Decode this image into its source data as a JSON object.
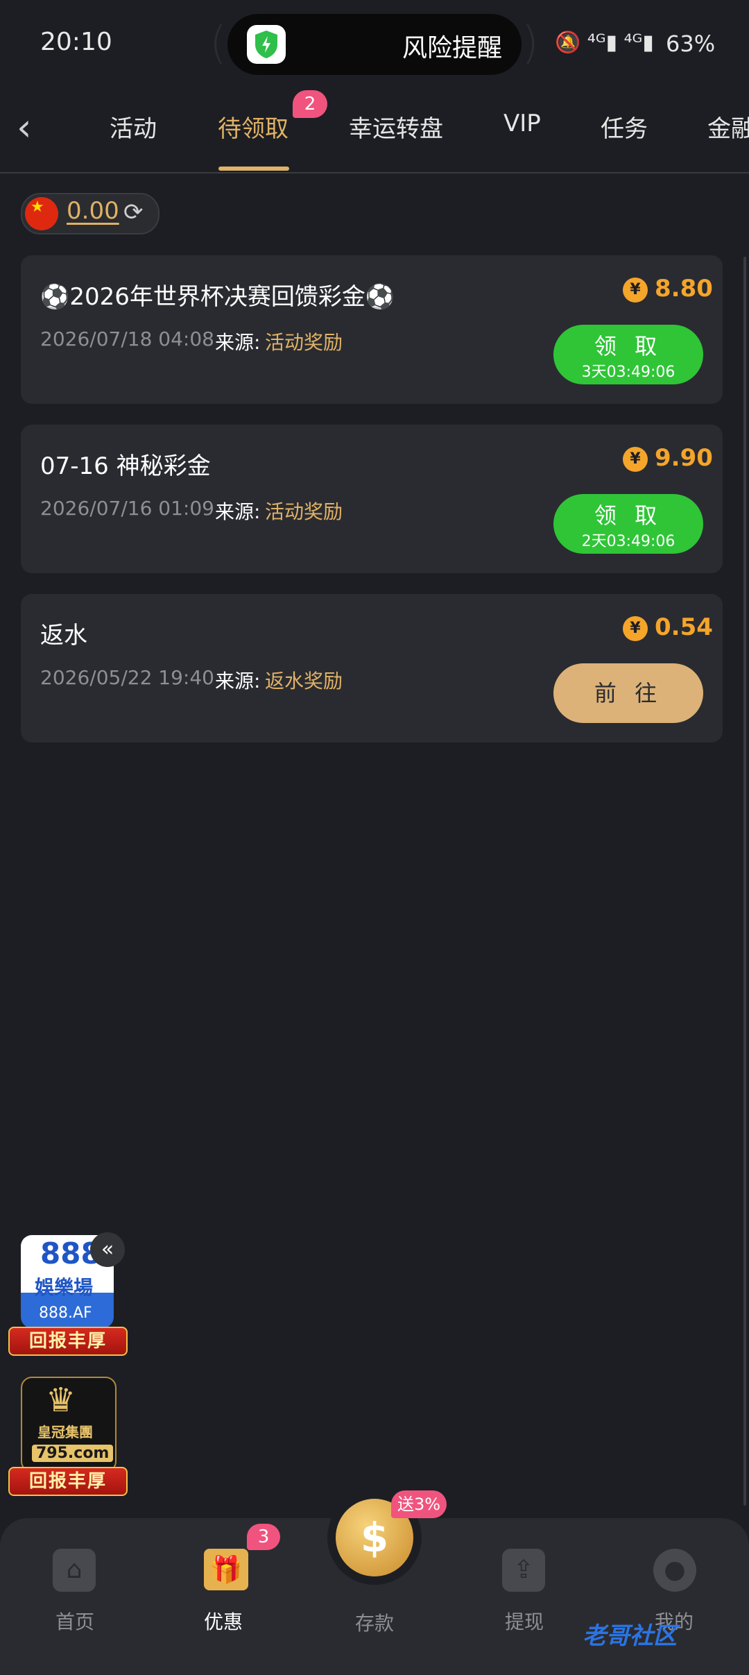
{
  "status_bar": {
    "time": "20:10",
    "island_text": "风险提醒",
    "signal": "🔕 ⁴ᴳ▮ ⁴ᴳ▮",
    "battery": "63%"
  },
  "tabs": {
    "items": [
      {
        "label": "活动"
      },
      {
        "label": "待领取",
        "badge": "2"
      },
      {
        "label": "幸运转盘"
      },
      {
        "label": "VIP"
      },
      {
        "label": "任务"
      },
      {
        "label": "金融"
      }
    ]
  },
  "balance": {
    "flag_icon": "china-flag-icon",
    "amount": "0.00",
    "refresh_icon": "refresh-icon"
  },
  "rewards": [
    {
      "title": "⚽2026年世界杯决赛回馈彩金⚽",
      "date": "2026/07/18 04:08",
      "source_label": "来源:",
      "source": "活动奖励",
      "currency": "¥",
      "amount": "8.80",
      "action_label": "领 取",
      "timer": "3天03:49:06"
    },
    {
      "title": "07-16 神秘彩金",
      "date": "2026/07/16 01:09",
      "source_label": "来源:",
      "source": "活动奖励",
      "currency": "¥",
      "amount": "9.90",
      "action_label": "领 取",
      "timer": "2天03:49:06"
    },
    {
      "title": "返水",
      "date": "2026/05/22 19:40",
      "source_label": "来源:",
      "source": "返水奖励",
      "currency": "¥",
      "amount": "0.54",
      "action_label": "前 往"
    }
  ],
  "side_ads": {
    "collapse": "«",
    "ad1": {
      "logo": "888",
      "name": "娛樂場",
      "url": "888.AF",
      "ribbon": "回报丰厚"
    },
    "ad2": {
      "logo": "♛",
      "name": "皇冠集團",
      "url": "795.com",
      "ribbon": "回报丰厚"
    }
  },
  "bottom_nav": {
    "home": "首页",
    "promo": "优惠",
    "promo_badge": "3",
    "deposit": "存款",
    "deposit_badge": "送3%",
    "withdraw": "提现",
    "mine": "我的"
  },
  "watermark": "老哥社区",
  "colors": {
    "background": "#1d1e23",
    "card": "#2a2b30",
    "accent_gold": "#e0b266",
    "amount_orange": "#f4a52a",
    "claim_green": "#2fc537",
    "badge_pink": "#f0547e"
  }
}
